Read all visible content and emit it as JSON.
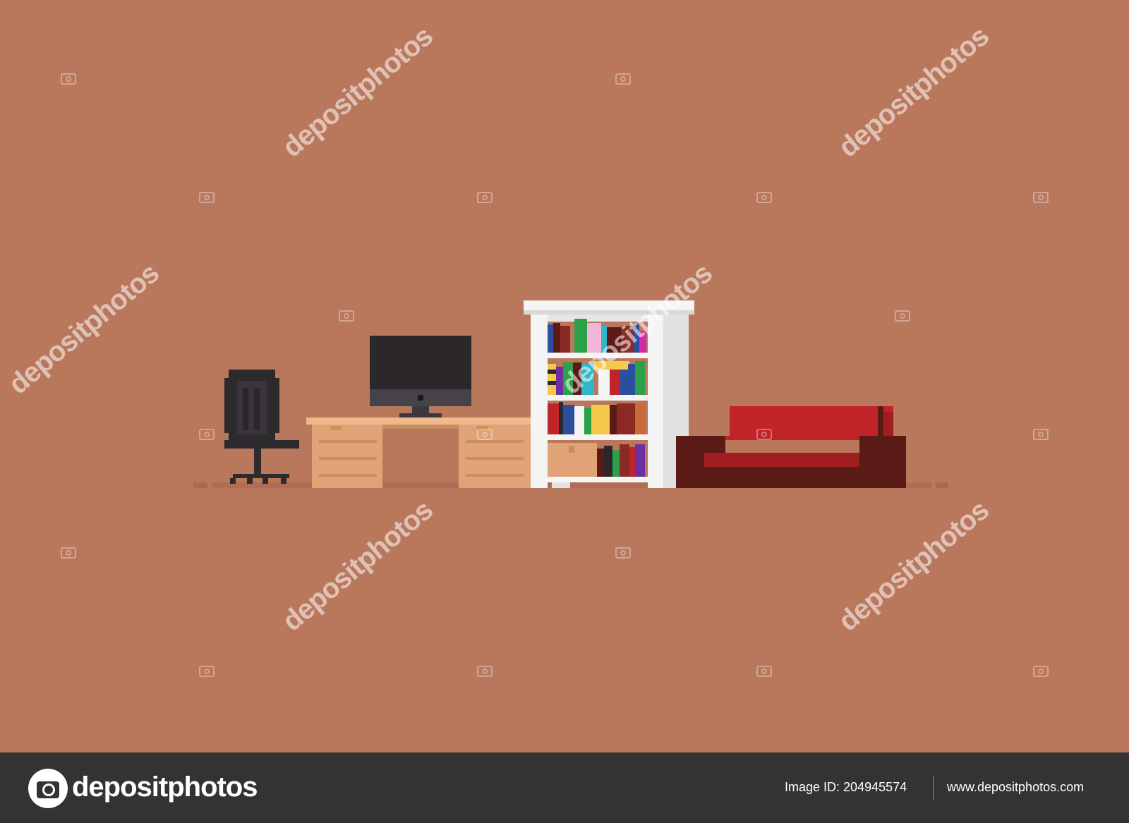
{
  "watermark": {
    "text": "depositphotos"
  },
  "footer": {
    "brand": "depositphotos",
    "image_id_label": "Image ID:",
    "image_id": "204945574",
    "website": "www.depositphotos.com"
  },
  "colors": {
    "background": "#b9775c",
    "footer": "#333333",
    "desk": "#e0a378",
    "chair": "#2d2a2e",
    "monitor": "#2b272a",
    "shelf": "#f4f4f4",
    "sofa": "#c02428",
    "sofa_dark": "#5a1a15"
  }
}
